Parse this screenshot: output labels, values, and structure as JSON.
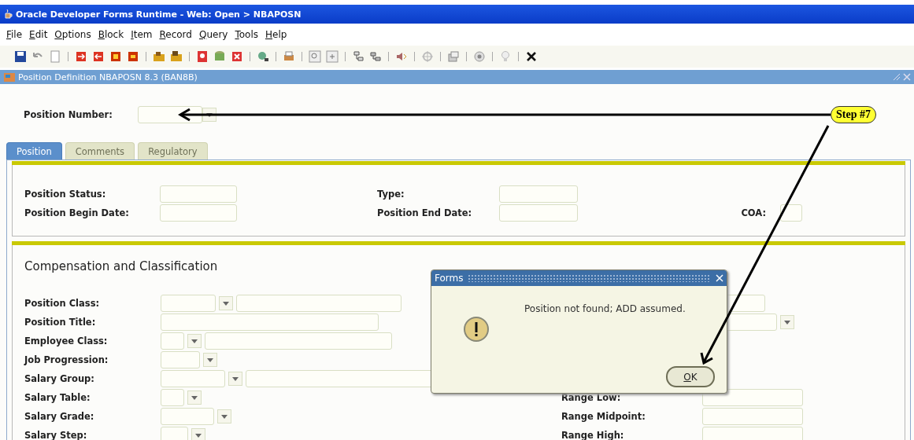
{
  "window": {
    "title": "Oracle Developer Forms Runtime - Web:  Open > NBAPOSN"
  },
  "menu": [
    "File",
    "Edit",
    "Options",
    "Block",
    "Item",
    "Record",
    "Query",
    "Tools",
    "Help"
  ],
  "form": {
    "title": "Position Definition  NBAPOSN  8.3  (BAN8B)"
  },
  "key_block": {
    "label": "Position Number:"
  },
  "tabs": [
    {
      "label": "Position",
      "selected": true
    },
    {
      "label": "Comments",
      "selected": false
    },
    {
      "label": "Regulatory",
      "selected": false
    }
  ],
  "position_panel": {
    "fields": [
      {
        "label": "Position Status:"
      },
      {
        "label": "Type:"
      },
      {
        "label": "Position Begin Date:"
      },
      {
        "label": "Position End Date:"
      },
      {
        "label": "COA:"
      }
    ]
  },
  "compensation": {
    "title": "Compensation and Classification",
    "fields": [
      {
        "label": "Position Class:",
        "kind": "lookup"
      },
      {
        "label": "Position Title:",
        "kind": "text"
      },
      {
        "label": "Employee Class:",
        "kind": "lookup"
      },
      {
        "label": "Job Progression:",
        "kind": "code"
      },
      {
        "label": "Salary Group:",
        "kind": "lookup"
      },
      {
        "label": "Salary Table:",
        "kind": "code"
      },
      {
        "label": "Salary Grade:",
        "kind": "code"
      },
      {
        "label": "Salary Step:",
        "kind": "code"
      }
    ],
    "right_fields": [
      {
        "kind": "text"
      },
      {
        "kind": "code"
      },
      {
        "label": "Range Low:",
        "kind": "text"
      },
      {
        "label": "Range Midpoint:",
        "kind": "text"
      },
      {
        "label": "Range High:",
        "kind": "text"
      }
    ]
  },
  "dialog": {
    "title": "Forms",
    "message": "Position not found; ADD assumed.",
    "button": "OK"
  },
  "annotation": {
    "label": "Step #7"
  }
}
